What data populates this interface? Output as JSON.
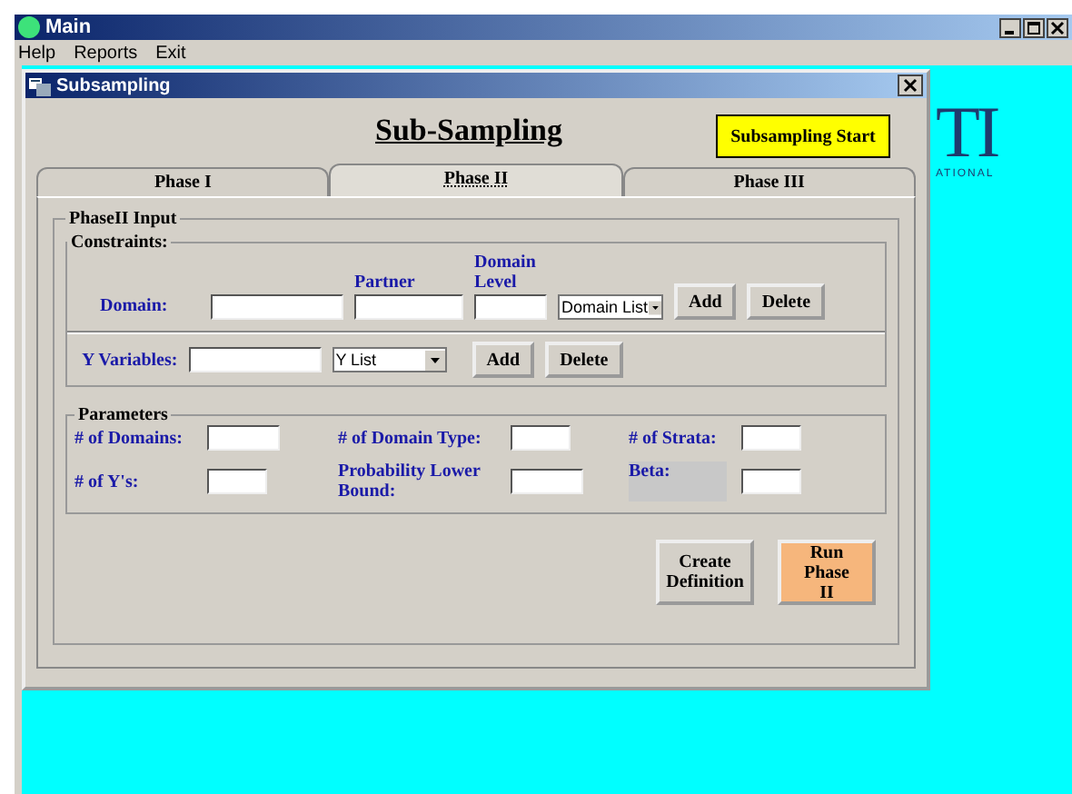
{
  "main_window": {
    "title": "Main",
    "menu": [
      "Help",
      "Reports",
      "Exit"
    ]
  },
  "logo": {
    "text": "TI",
    "subtext": "ATIONAL"
  },
  "dialog": {
    "title": "Subsampling",
    "heading": "Sub-Sampling",
    "start_button": "Subsampling Start",
    "tabs": [
      {
        "label": "Phase I",
        "selected": false
      },
      {
        "label": "Phase II",
        "selected": true
      },
      {
        "label": "Phase III",
        "selected": false
      }
    ],
    "input_group": {
      "title": "PhaseII Input",
      "constraints": {
        "title": "Constraints:",
        "domain_label": "Domain:",
        "partner_label": "Partner",
        "domain_level_label": "Domain Level",
        "dropdown": "Domain List",
        "buttons": [
          "Add",
          "Delete"
        ]
      },
      "y_variables": {
        "label": "Y Variables:",
        "dropdown": "Y List",
        "buttons": [
          "Add",
          "Delete"
        ]
      },
      "parameters": {
        "title": "Parameters",
        "fields": [
          {
            "label": "# of Domains:",
            "shaded": false
          },
          {
            "label": "# of Domain Type:",
            "shaded": false
          },
          {
            "label": "# of Strata:",
            "shaded": false
          },
          {
            "label": "# of Y's:",
            "shaded": false
          },
          {
            "label": "Probability Lower Bound:",
            "shaded": false
          },
          {
            "label": "Beta:",
            "shaded": true
          }
        ]
      },
      "actions": [
        {
          "label": "Create Definition",
          "kind": "normal"
        },
        {
          "label": "Run Phase II",
          "kind": "primary"
        }
      ]
    }
  }
}
